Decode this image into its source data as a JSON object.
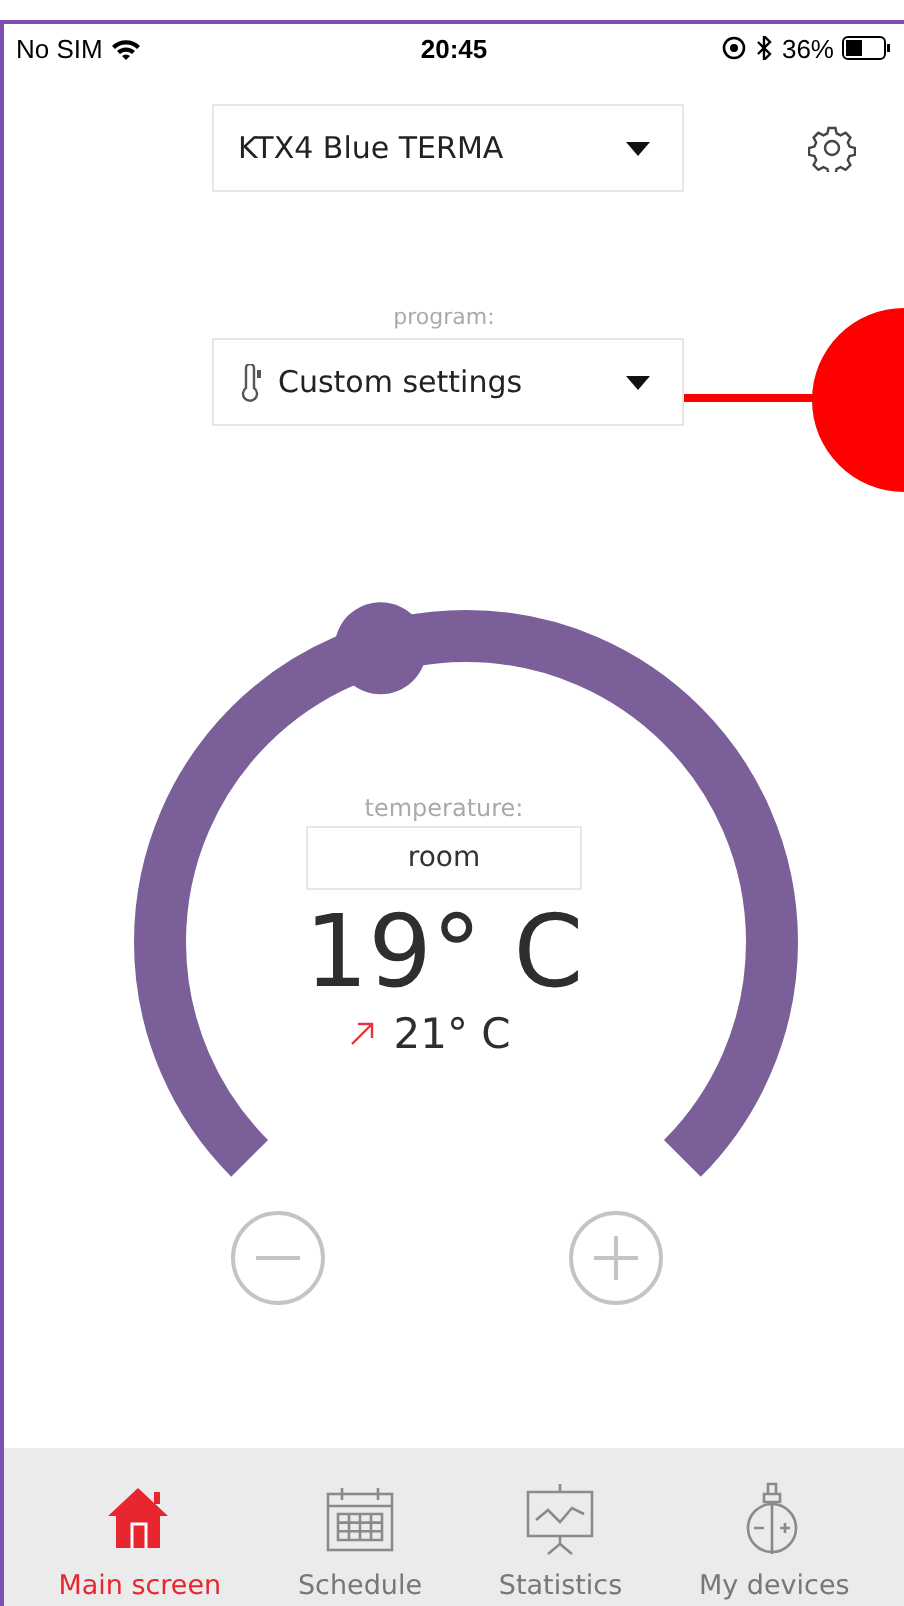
{
  "status_bar": {
    "carrier": "No SIM",
    "time": "20:45",
    "battery": "36%"
  },
  "device_select": {
    "value": "KTX4 Blue TERMA"
  },
  "program": {
    "label": "program:",
    "value": "Custom settings"
  },
  "temperature": {
    "label": "temperature:",
    "mode": "room",
    "value": "19° C",
    "target": "21° C",
    "level": 0.44
  },
  "nav": [
    {
      "label": "Main screen",
      "kind": "home",
      "selected": true
    },
    {
      "label": "Schedule",
      "kind": "calendar",
      "selected": false
    },
    {
      "label": "Statistics",
      "kind": "chart",
      "selected": false
    },
    {
      "label": "My devices",
      "kind": "device",
      "selected": false
    }
  ]
}
